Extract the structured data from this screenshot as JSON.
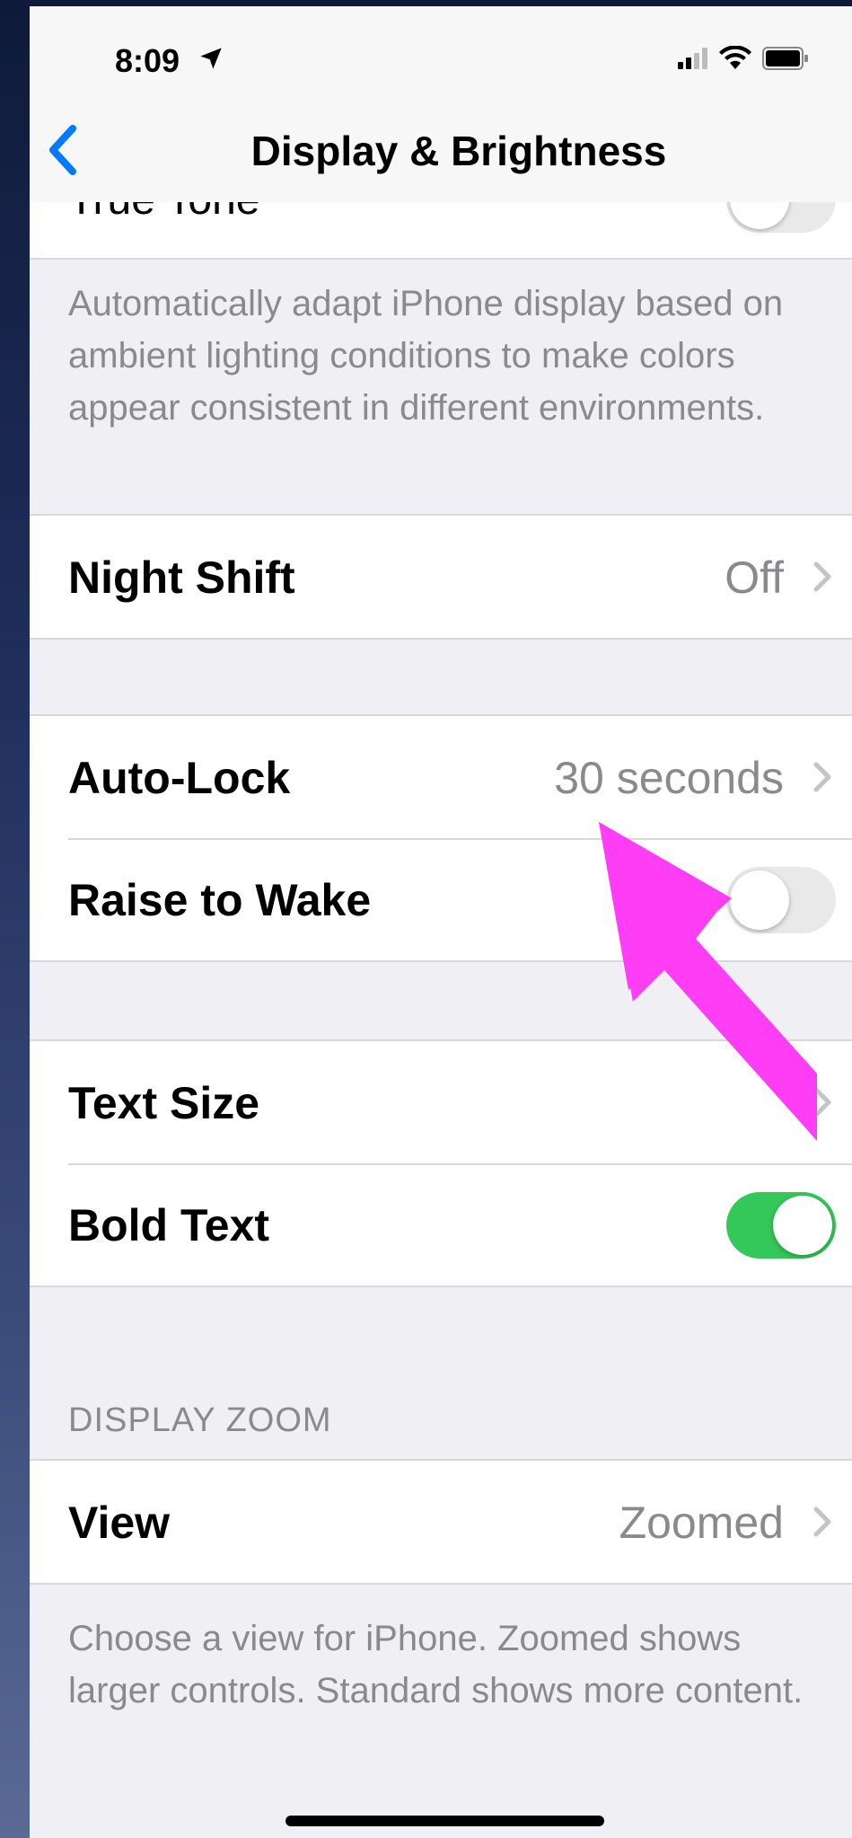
{
  "status_bar": {
    "time": "8:09"
  },
  "nav": {
    "title": "Display & Brightness"
  },
  "true_tone": {
    "label": "True Tone",
    "footer": "Automatically adapt iPhone display based on ambient lighting conditions to make colors appear consistent in different environments."
  },
  "night_shift": {
    "label": "Night Shift",
    "value": "Off"
  },
  "auto_lock": {
    "label": "Auto-Lock",
    "value": "30 seconds"
  },
  "raise_to_wake": {
    "label": "Raise to Wake",
    "enabled": false
  },
  "text_size": {
    "label": "Text Size"
  },
  "bold_text": {
    "label": "Bold Text",
    "enabled": true
  },
  "display_zoom": {
    "header": "DISPLAY ZOOM",
    "view_label": "View",
    "view_value": "Zoomed",
    "footer": "Choose a view for iPhone. Zoomed shows larger controls. Standard shows more content."
  },
  "colors": {
    "toggle_on": "#34c759",
    "accent": "#007aff",
    "annotation_arrow": "#ff3df5"
  }
}
